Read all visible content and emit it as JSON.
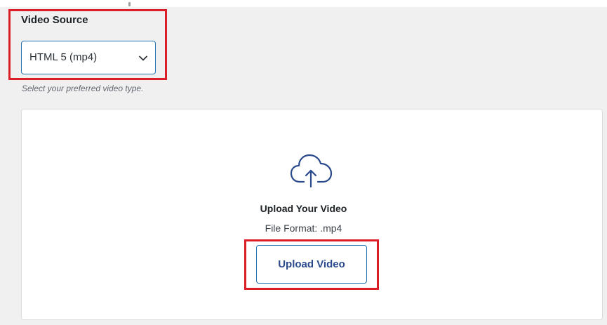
{
  "video_source": {
    "title": "Video Source",
    "selected_value": "HTML 5 (mp4)",
    "help_text": "Select your preferred video type."
  },
  "upload": {
    "icon": "cloud-upload-icon",
    "title": "Upload Your Video",
    "format_text": "File Format: .mp4",
    "button_label": "Upload Video"
  },
  "colors": {
    "accent": "#2271b1",
    "highlight": "#dc1e28",
    "panel_background": "#f0f0f1"
  }
}
